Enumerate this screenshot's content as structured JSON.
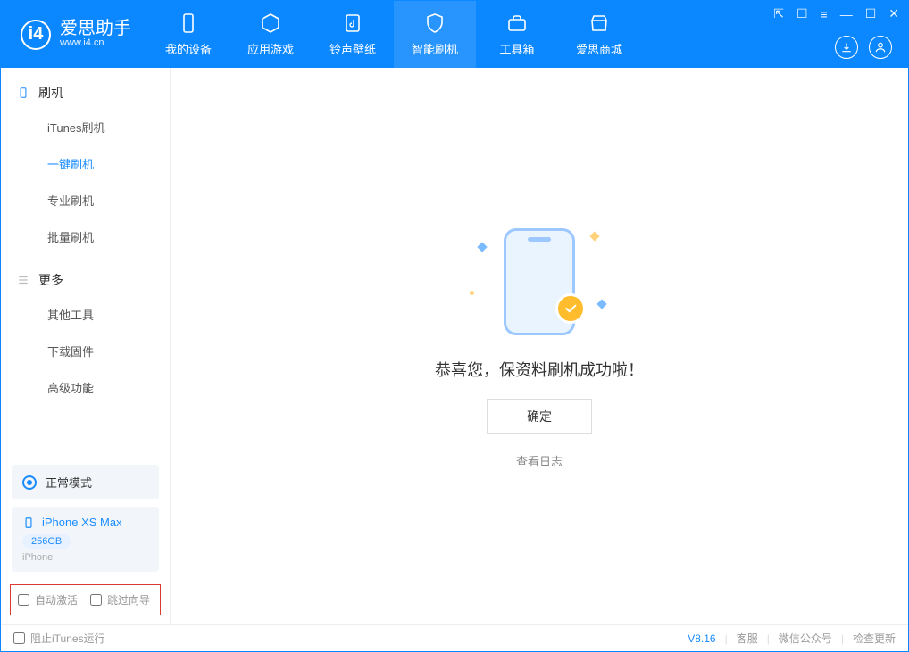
{
  "app": {
    "name_cn": "爱思助手",
    "name_en": "www.i4.cn"
  },
  "nav": {
    "items": [
      {
        "label": "我的设备"
      },
      {
        "label": "应用游戏"
      },
      {
        "label": "铃声壁纸"
      },
      {
        "label": "智能刷机"
      },
      {
        "label": "工具箱"
      },
      {
        "label": "爱思商城"
      }
    ]
  },
  "sidebar": {
    "group1_title": "刷机",
    "group1_items": [
      "iTunes刷机",
      "一键刷机",
      "专业刷机",
      "批量刷机"
    ],
    "group2_title": "更多",
    "group2_items": [
      "其他工具",
      "下载固件",
      "高级功能"
    ],
    "status_label": "正常模式",
    "device_name": "iPhone XS Max",
    "device_capacity": "256GB",
    "device_type": "iPhone",
    "check_auto_activate": "自动激活",
    "check_skip_guide": "跳过向导"
  },
  "main": {
    "success_text": "恭喜您，保资料刷机成功啦！",
    "ok_label": "确定",
    "view_log": "查看日志"
  },
  "footer": {
    "block_itunes": "阻止iTunes运行",
    "version": "V8.16",
    "support": "客服",
    "wechat": "微信公众号",
    "check_update": "检查更新"
  }
}
